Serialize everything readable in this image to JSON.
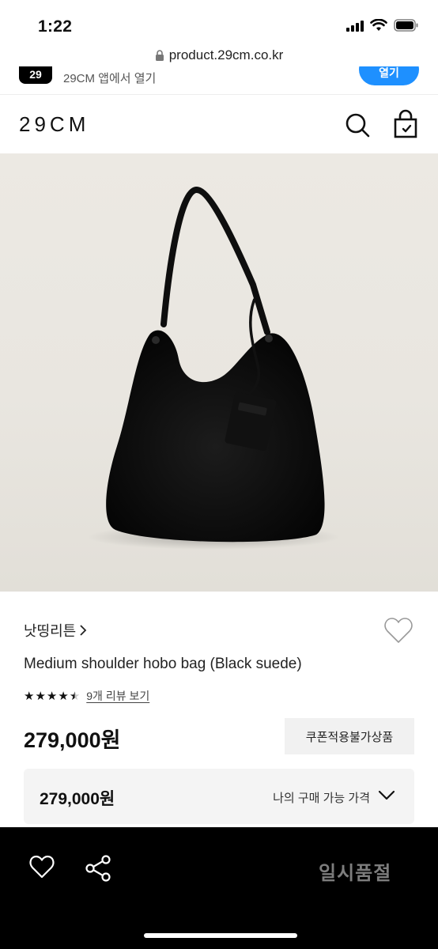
{
  "status_bar": {
    "time": "1:22"
  },
  "browser": {
    "url": "product.29cm.co.kr"
  },
  "app_banner": {
    "logo_text": "29",
    "text": "29CM 앱에서 열기",
    "button_label": "열기"
  },
  "header": {
    "logo": "29CM"
  },
  "product": {
    "brand": "낫띵리튼",
    "name": "Medium shoulder hobo bag (Black suede)",
    "rating": 4.5,
    "review_link": "9개 리뷰 보기",
    "price": "279,000원",
    "coupon_badge": "쿠폰적용불가상품",
    "my_price": "279,000원",
    "my_price_label": "나의 구매 가능 가격"
  },
  "bottom_bar": {
    "status_label": "일시품절"
  },
  "icons": {
    "search": "search-icon",
    "cart": "shopping-bag-icon",
    "wishlist": "heart-icon",
    "share": "share-icon",
    "chevron": "chevron-down-icon"
  },
  "colors": {
    "accent_blue": "#1e90ff",
    "bottom_bar": "#000000",
    "soldout_text": "#7d7d7d"
  }
}
